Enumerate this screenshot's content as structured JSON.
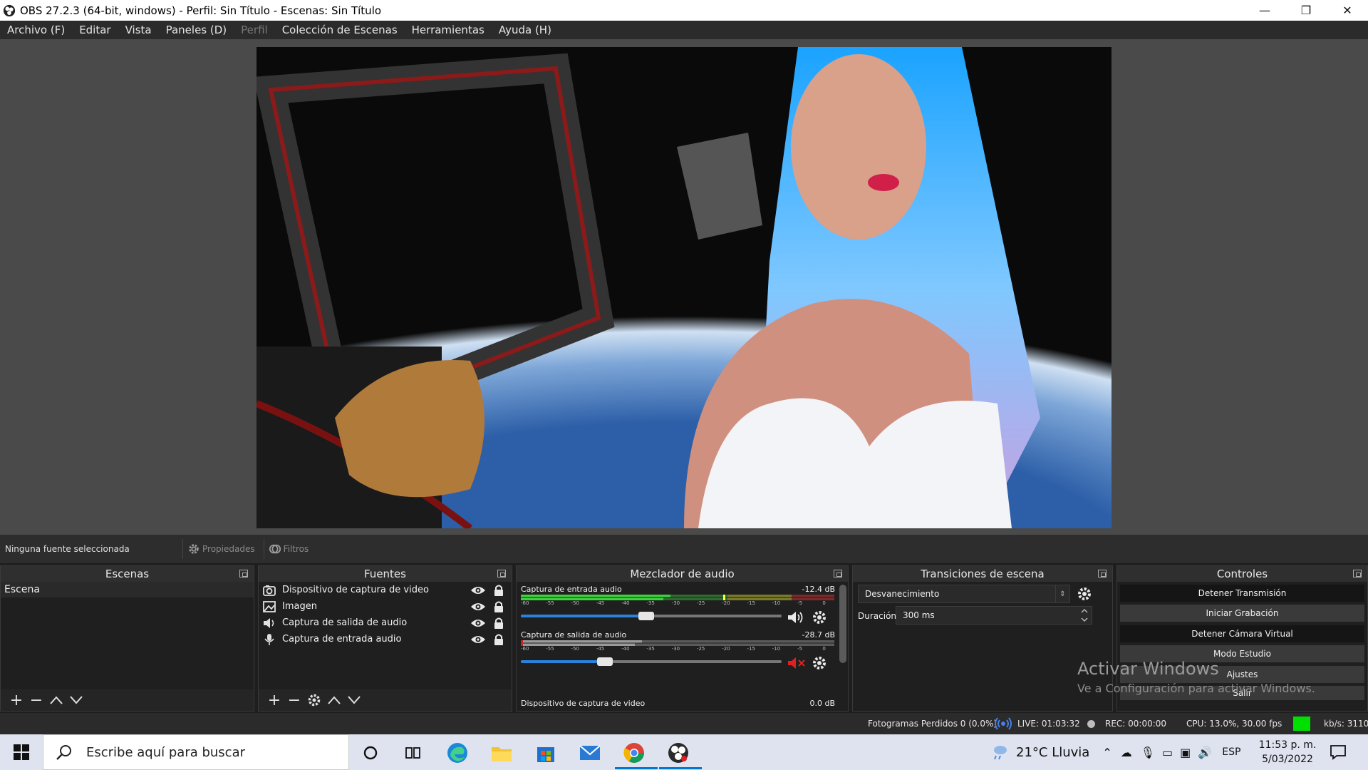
{
  "titlebar": {
    "title": "OBS 27.2.3 (64-bit, windows) - Perfil: Sin Título - Escenas: Sin Título",
    "controls": [
      "—",
      "❐",
      "✕"
    ]
  },
  "menu": [
    {
      "label": "Archivo (F)",
      "disabled": false
    },
    {
      "label": "Editar",
      "disabled": false
    },
    {
      "label": "Vista",
      "disabled": false
    },
    {
      "label": "Paneles (D)",
      "disabled": false
    },
    {
      "label": "Perfil",
      "disabled": true
    },
    {
      "label": "Colección de Escenas",
      "disabled": false
    },
    {
      "label": "Herramientas",
      "disabled": false
    },
    {
      "label": "Ayuda (H)",
      "disabled": false
    }
  ],
  "source_toolbar": {
    "no_selection": "Ninguna fuente seleccionada",
    "properties": "Propiedades",
    "filters": "Filtros"
  },
  "docks": {
    "scenes": {
      "title": "Escenas",
      "items": [
        "Escena"
      ]
    },
    "sources": {
      "title": "Fuentes",
      "items": [
        {
          "label": "Dispositivo de captura de video",
          "icon": "camera-icon"
        },
        {
          "label": "Imagen",
          "icon": "image-icon"
        },
        {
          "label": "Captura de salida de audio",
          "icon": "speaker-icon"
        },
        {
          "label": "Captura de entrada audio",
          "icon": "microphone-icon"
        }
      ]
    },
    "mixer": {
      "title": "Mezclador de audio",
      "tracks": [
        {
          "name": "Captura de entrada audio",
          "db": "-12.4 dB",
          "volume": 0.48,
          "muted": false
        },
        {
          "name": "Captura de salida de audio",
          "db": "-28.7 dB",
          "volume": 0.31,
          "muted": true
        },
        {
          "name": "Dispositivo de captura de video",
          "db": "0.0 dB"
        }
      ],
      "tick_labels": [
        "-60",
        "-55",
        "-50",
        "-45",
        "-40",
        "-35",
        "-30",
        "-25",
        "-20",
        "-15",
        "-10",
        "-5",
        "0"
      ]
    },
    "transitions": {
      "title": "Transiciones de escena",
      "selected": "Desvanecimiento",
      "duration_label": "Duración",
      "duration_value": "300 ms"
    },
    "controls": {
      "title": "Controles",
      "buttons": [
        {
          "label": "Detener Transmisión",
          "active": true
        },
        {
          "label": "Iniciar Grabación",
          "active": false
        },
        {
          "label": "Detener Cámara Virtual",
          "active": true
        },
        {
          "label": "Modo Estudio",
          "active": false
        },
        {
          "label": "Ajustes",
          "active": false
        },
        {
          "label": "Salir",
          "active": false
        }
      ]
    }
  },
  "watermark": {
    "line1": "Activar Windows",
    "line2": "Ve a Configuración para activar Windows."
  },
  "statusbar": {
    "dropped": "Fotogramas Perdidos 0 (0.0%)",
    "live": "LIVE: 01:03:32",
    "rec": "REC: 00:00:00",
    "cpu": "CPU: 13.0%, 30.00 fps",
    "kbs": "kb/s: 3110",
    "health_color": "#00e000"
  },
  "taskbar": {
    "search_placeholder": "Escribe aquí para buscar",
    "weather": "21°C  Lluvia",
    "language": "ESP",
    "time": "11:53 p. m.",
    "date": "5/03/2022",
    "accent": "#0078d4"
  }
}
